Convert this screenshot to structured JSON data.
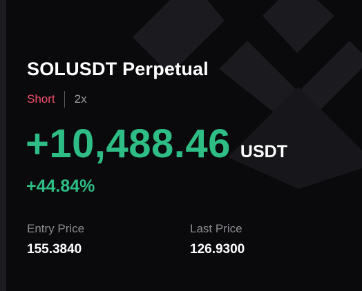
{
  "position": {
    "symbol_title": "SOLUSDT Perpetual",
    "side": "Short",
    "leverage": "2x",
    "pnl_value": "+10,488.46",
    "pnl_unit": "USDT",
    "pnl_percent": "+44.84%"
  },
  "stats": {
    "entry_price_label": "Entry Price",
    "entry_price_value": "155.3840",
    "last_price_label": "Last Price",
    "last_price_value": "126.9300"
  },
  "colors": {
    "background": "#0a0a0c",
    "profit_green": "#2ebd85",
    "short_red": "#f0506e",
    "muted_text": "#8c8c92",
    "logo_watermark": "#1b1b1f"
  },
  "icons": {
    "background_watermark": "exchange-logo-watermark-icon"
  }
}
